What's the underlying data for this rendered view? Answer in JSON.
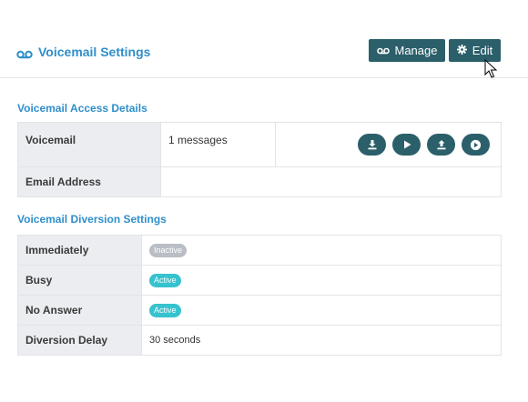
{
  "header": {
    "title": "Voicemail Settings",
    "manage_label": "Manage",
    "edit_label": "Edit"
  },
  "access": {
    "section_title": "Voicemail Access Details",
    "rows": [
      {
        "label": "Voicemail",
        "value": "1 messages"
      },
      {
        "label": "Email Address",
        "value": ""
      }
    ],
    "actions": [
      "download-icon",
      "play-icon",
      "upload-icon",
      "play-circle-icon"
    ]
  },
  "diversion": {
    "section_title": "Voicemail Diversion Settings",
    "rows": [
      {
        "label": "Immediately",
        "value": "Inactive",
        "status_color": "#b9bec4"
      },
      {
        "label": "Busy",
        "value": "Active",
        "status_color": "#36c2cf"
      },
      {
        "label": "No Answer",
        "value": "Active",
        "status_color": "#36c2cf"
      },
      {
        "label": "Diversion Delay",
        "value": "30 seconds"
      }
    ]
  },
  "colors": {
    "accent": "#2f8fca",
    "button": "#2b5f6a",
    "active": "#36c2cf",
    "inactive": "#b9bec4"
  }
}
